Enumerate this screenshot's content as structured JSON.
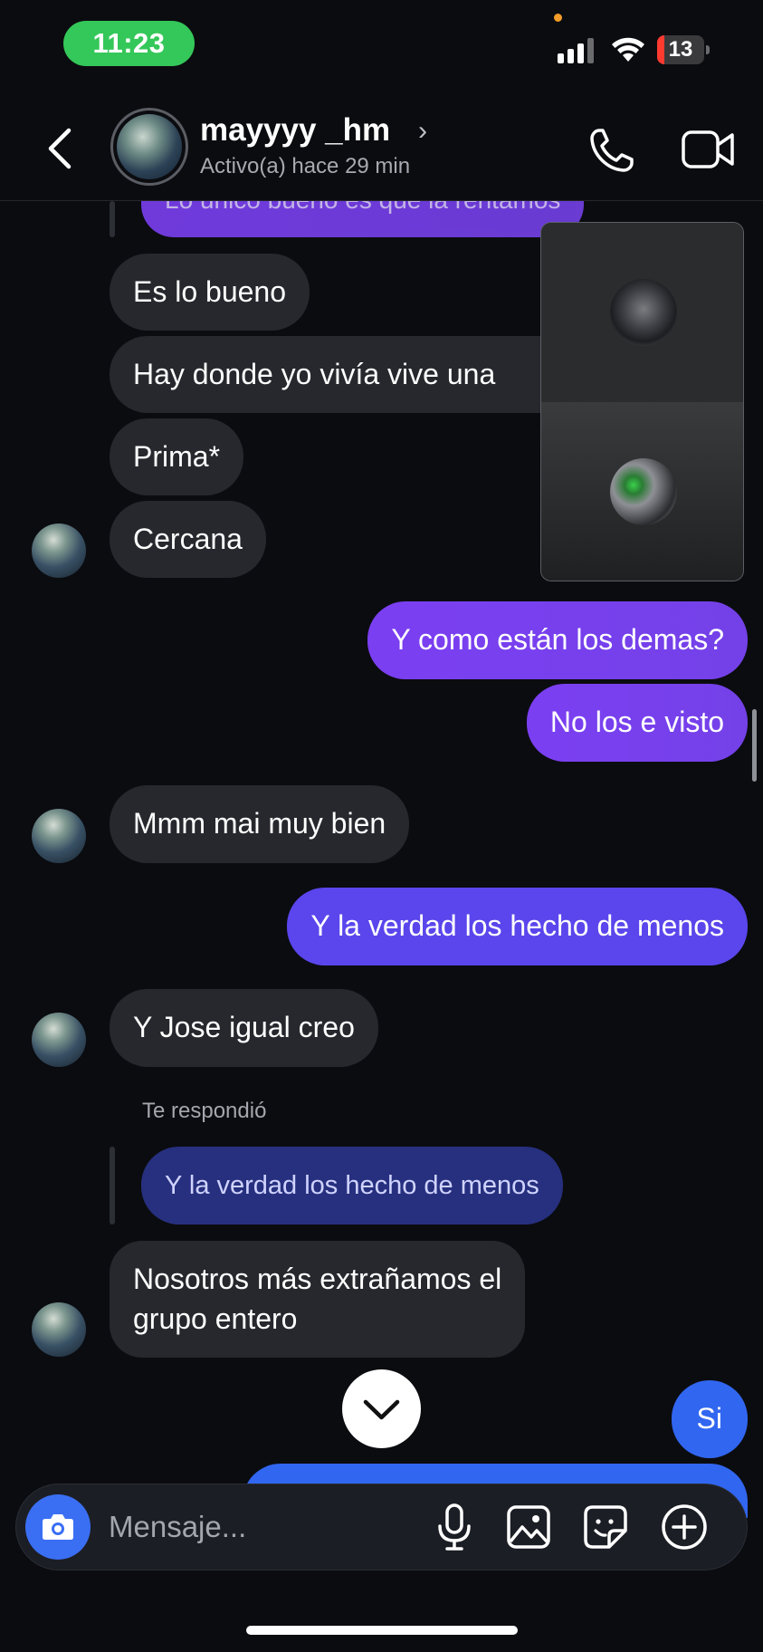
{
  "status_bar": {
    "time": "11:23",
    "battery": "13"
  },
  "header": {
    "name": "mayyyy _hm",
    "chevron": "›",
    "status": "Activo(a) hace 29 min"
  },
  "messages": {
    "partial_top": "Lo único bueno es que la rentamos",
    "m1": "Es lo bueno",
    "m2": "Hay donde yo vivía vive una",
    "m3": "Prima*",
    "m4": "Cercana",
    "m5": "Y como están los demas?",
    "m6": "No los e visto",
    "m7": "Mmm mai muy bien",
    "m8": "Y la verdad los hecho de menos",
    "m9": "Y Jose igual creo",
    "replied_label": "Te respondió",
    "quoted": "Y la verdad los hecho de menos",
    "m10_line1": "Nosotros más extrañamos el",
    "m10_line2": "grupo entero",
    "m11": "Si"
  },
  "composer": {
    "placeholder": "Mensaje..."
  },
  "colors": {
    "accent_purple": "#7b3ff2",
    "accent_blue": "#3166f0",
    "background": "#0b0c10",
    "incoming": "#26282d"
  },
  "icons": [
    "back-arrow-icon",
    "chevron-right-icon",
    "phone-icon",
    "video-camera-icon",
    "camera-icon",
    "microphone-icon",
    "image-icon",
    "sticker-icon",
    "plus-circle-icon",
    "chevron-down-icon"
  ]
}
